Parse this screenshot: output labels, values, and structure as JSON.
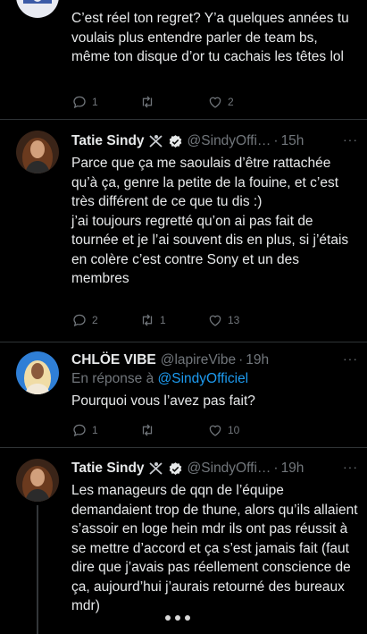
{
  "tweets": [
    {
      "body": "C’est réel ton regret? Y’a quelques années tu voulais plus entendre parler de team bs, même ton disque d’or tu cachais les têtes lol",
      "reply_count": "1",
      "retweet_count": "",
      "like_count": "2"
    },
    {
      "name": "Tatie Sindy",
      "handle": "@SindyOffi…",
      "time": "15h",
      "body": "Parce que ça me saoulais d’être rattachée qu’à ça, genre la petite de la fouine, et c’est très différent de ce que tu dis :)\n j’ai toujours regretté qu’on ai pas fait de tournée et je l’ai souvent dis en plus, si j’étais en colère c’est contre Sony et un des membres",
      "reply_count": "2",
      "retweet_count": "1",
      "like_count": "13"
    },
    {
      "name": "CHLÖE VIBE",
      "handle": "@lapireVibe",
      "time": "19h",
      "reply_prefix": "En réponse à",
      "reply_mention": "@SindyOfficiel",
      "body": "Pourquoi vous l’avez pas fait?",
      "reply_count": "1",
      "retweet_count": "",
      "like_count": "10"
    },
    {
      "name": "Tatie Sindy",
      "handle": "@SindyOffi…",
      "time": "19h",
      "body": "Les manageurs de qqn de l’équipe demandaient trop de thune, alors qu’ils allaient s’assoir en loge hein mdr  ils ont pas réussit à se mettre d’accord et ça s’est jamais fait (faut dire que j’avais pas réellement conscience de ça, aujourd’hui j’aurais retourné des bureaux mdr)"
    }
  ],
  "ui": {
    "separator": "·",
    "more": "···"
  },
  "icons": {
    "reply": "reply-icon",
    "retweet": "retweet-icon",
    "like": "heart-icon",
    "verified": "verified-badge-icon",
    "emoji": "fencing-emoji-icon"
  },
  "colors": {
    "background": "#000000",
    "text": "#e7e9ea",
    "secondary": "#71767b",
    "link": "#1d9bf0",
    "divider": "#2f3336"
  }
}
